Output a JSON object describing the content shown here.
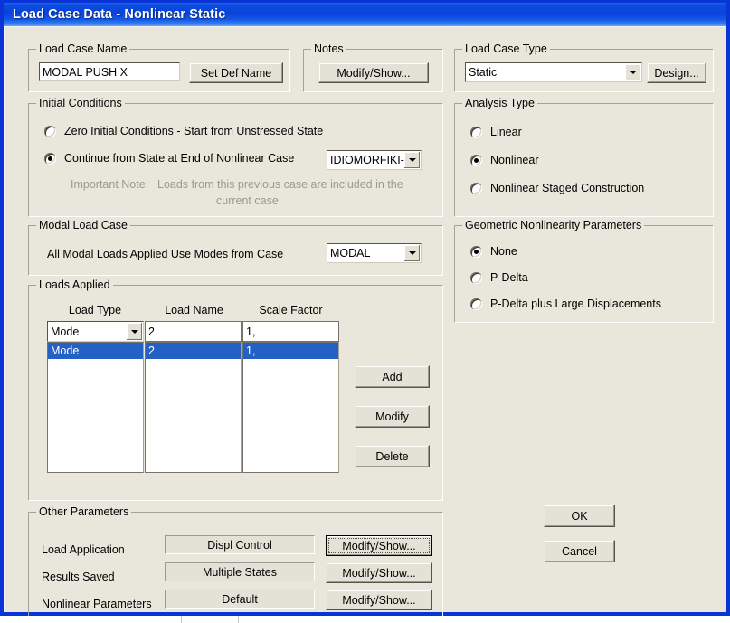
{
  "window": {
    "title": "Load Case Data - Nonlinear Static",
    "title_bar_color": "#0a42dc",
    "client_color": "#e9e7dc"
  },
  "load_case_name": {
    "group_title": "Load Case Name",
    "value": "MODAL PUSH X",
    "set_def_name_button": "Set Def Name"
  },
  "notes": {
    "group_title": "Notes",
    "modify_show_button": "Modify/Show..."
  },
  "load_case_type": {
    "group_title": "Load Case Type",
    "selected": "Static",
    "design_button": "Design..."
  },
  "initial_conditions": {
    "group_title": "Initial Conditions",
    "option_zero": "Zero Initial Conditions - Start from Unstressed State",
    "option_continue": "Continue from State at End of Nonlinear Case",
    "selected": "continue",
    "case_combo_value": "IDIOMORFIKI-X",
    "note_label": "Important Note:",
    "note_line1": "Loads from this previous case are included in the",
    "note_line2": "current case"
  },
  "analysis_type": {
    "group_title": "Analysis Type",
    "options": [
      "Linear",
      "Nonlinear",
      "Nonlinear Staged Construction"
    ],
    "selected_index": 1
  },
  "modal_load_case": {
    "group_title": "Modal Load Case",
    "label": "All Modal Loads Applied Use Modes from Case",
    "combo_value": "MODAL"
  },
  "geometric_nonlinearity": {
    "group_title": "Geometric Nonlinearity Parameters",
    "options": [
      "None",
      "P-Delta",
      "P-Delta plus Large Displacements"
    ],
    "selected_index": 0
  },
  "loads_applied": {
    "group_title": "Loads Applied",
    "columns": [
      "Load Type",
      "Load Name",
      "Scale Factor"
    ],
    "editor_row": {
      "load_type": "Mode",
      "load_name": "2",
      "scale_factor": "1,"
    },
    "rows": [
      {
        "load_type": "Mode",
        "load_name": "2",
        "scale_factor": "1,"
      }
    ],
    "add_button": "Add",
    "modify_button": "Modify",
    "delete_button": "Delete",
    "selection_color": "#2361c4"
  },
  "other_parameters": {
    "group_title": "Other Parameters",
    "rows": [
      {
        "label": "Load Application",
        "value": "Displ Control",
        "button": "Modify/Show...",
        "focused": true
      },
      {
        "label": "Results Saved",
        "value": "Multiple States",
        "button": "Modify/Show...",
        "focused": false
      },
      {
        "label": "Nonlinear Parameters",
        "value": "Default",
        "button": "Modify/Show...",
        "focused": false
      }
    ]
  },
  "dialog_buttons": {
    "ok": "OK",
    "cancel": "Cancel"
  }
}
